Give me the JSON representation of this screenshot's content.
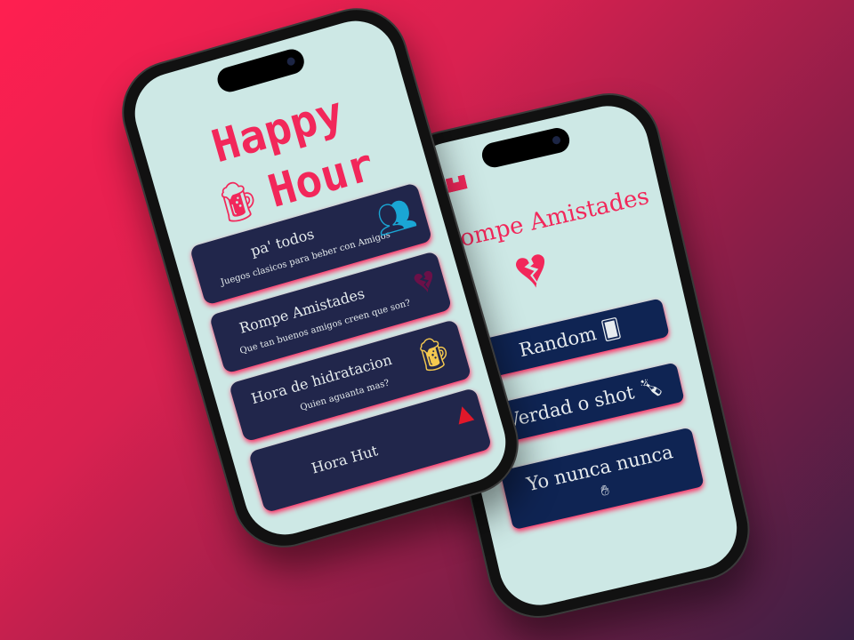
{
  "social": {
    "icon": "instagram-icon"
  },
  "main_phone": {
    "title_line1": "Happy",
    "title_line2": "Hour",
    "cards": [
      {
        "title": "pa' todos",
        "subtitle": "Juegos clasicos para beber con Amigos",
        "icon": "group-icon",
        "icon_color": "#1aa6d4"
      },
      {
        "title": "Rompe Amistades",
        "subtitle": "Que tan buenos amigos creen que son?",
        "icon": "broken-heart-icon",
        "icon_color": "#6b1048"
      },
      {
        "title": "Hora de hidratacion",
        "subtitle": "Quien aguanta mas?",
        "icon": "beer-mug-icon",
        "icon_color": "#f5c94f"
      },
      {
        "title": "Hora Hut",
        "subtitle": "",
        "icon": "flame-icon",
        "icon_color": "#e0182a"
      }
    ]
  },
  "game_phone": {
    "title": "Rompe Amistades",
    "buttons": [
      {
        "label": "Random",
        "icon": "cards-icon"
      },
      {
        "label": "Verdad o shot",
        "icon": "bottle-icon"
      },
      {
        "label": "Yo nunca nunca",
        "icon": "hand-icon"
      }
    ]
  },
  "colors": {
    "accent": "#f2275a",
    "card": "#21264b",
    "button": "#0f2453",
    "screen": "#cde8e5"
  }
}
